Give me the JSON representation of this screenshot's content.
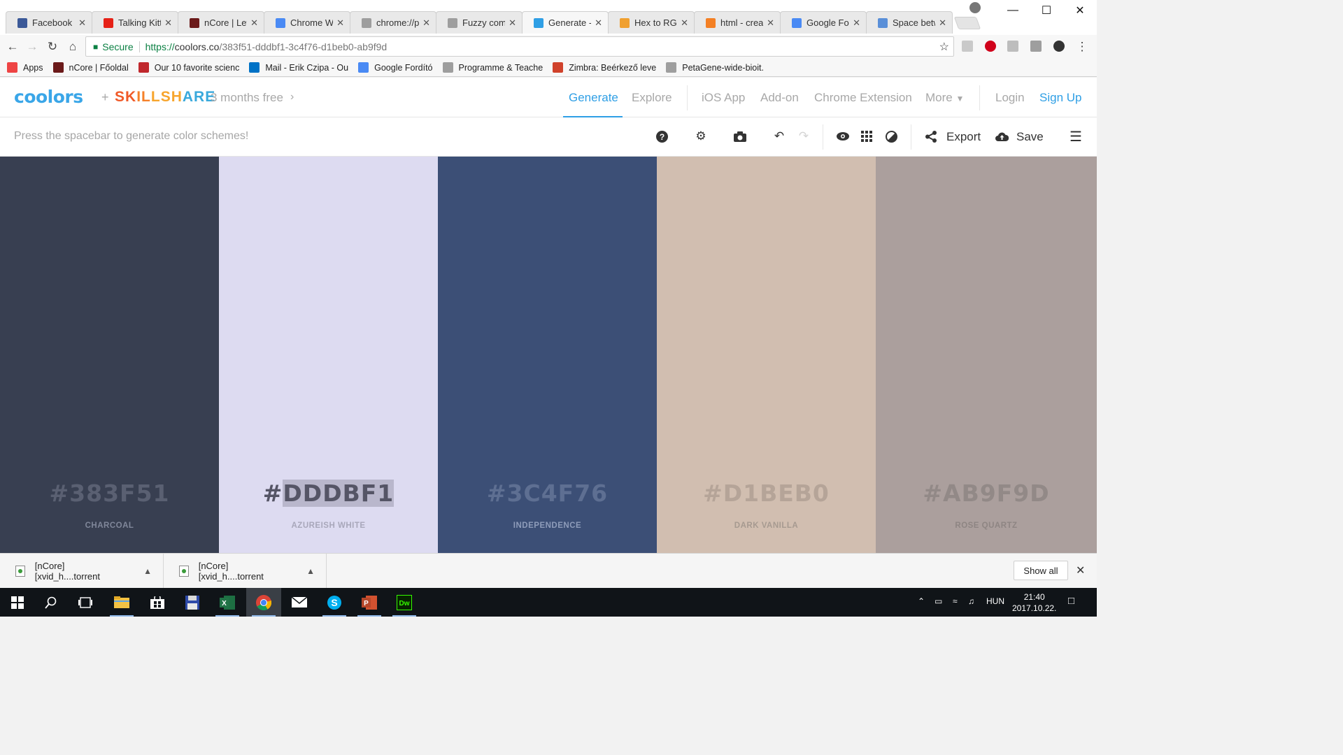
{
  "browser": {
    "tabs": [
      {
        "label": "Facebook",
        "icon": "facebook-icon",
        "color": "#3b5998"
      },
      {
        "label": "Talking Kitty",
        "icon": "youtube-icon",
        "color": "#e62117"
      },
      {
        "label": "nCore | Letöltés",
        "icon": "ncore-icon",
        "color": "#6b1a1a"
      },
      {
        "label": "Chrome Web Store",
        "icon": "chrome-webstore-icon",
        "color": "#4a8af4"
      },
      {
        "label": "chrome://plugins",
        "icon": "page-icon",
        "color": "#9e9e9e"
      },
      {
        "label": "Fuzzy comparison",
        "icon": "page-icon",
        "color": "#9e9e9e"
      },
      {
        "label": "Generate - Coolors",
        "icon": "coolors-icon",
        "color": "#2f9fe5",
        "active": true
      },
      {
        "label": "Hex to RGB",
        "icon": "r-icon",
        "color": "#f0a030"
      },
      {
        "label": "html - create",
        "icon": "stackoverflow-icon",
        "color": "#f48024"
      },
      {
        "label": "Google Fonts",
        "icon": "google-fonts-icon",
        "color": "#4a8af4"
      },
      {
        "label": "Space between",
        "icon": "codepen-icon",
        "color": "#5a8fd8"
      }
    ],
    "close_glyph": "✕",
    "address": {
      "secure_label": "Secure",
      "url_prefix": "https://",
      "url_host": "coolors.co",
      "url_path": "/383f51-dddbf1-3c4f76-d1beb0-ab9f9d"
    },
    "bookmarks": [
      {
        "label": "Apps",
        "icon": "apps-grid-icon",
        "color": "#e44"
      },
      {
        "label": "nCore | Főoldal",
        "icon": "ncore-icon",
        "color": "#6b1a1a"
      },
      {
        "label": "Our 10 favorite scienc",
        "icon": "s-icon",
        "color": "#c0282d"
      },
      {
        "label": "Mail - Erik Czipa - Ou",
        "icon": "outlook-icon",
        "color": "#0072c6"
      },
      {
        "label": "Google Fordító",
        "icon": "google-translate-icon",
        "color": "#4a8af4"
      },
      {
        "label": "Programme & Teache",
        "icon": "page-icon",
        "color": "#9e9e9e"
      },
      {
        "label": "Zimbra: Beérkező leve",
        "icon": "zimbra-icon",
        "color": "#d0422b"
      },
      {
        "label": "PetaGene-wide-bioit.",
        "icon": "page-icon",
        "color": "#9e9e9e"
      }
    ]
  },
  "coolors": {
    "logo": "coolors",
    "plus": "+",
    "skillshare": [
      {
        "t": "S",
        "c": "#f05a28"
      },
      {
        "t": "K",
        "c": "#f05a28"
      },
      {
        "t": "I",
        "c": "#f5812a"
      },
      {
        "t": "L",
        "c": "#f5812a"
      },
      {
        "t": "L",
        "c": "#f7a52d"
      },
      {
        "t": "S",
        "c": "#f7a52d"
      },
      {
        "t": "H",
        "c": "#f7a52d"
      },
      {
        "t": "A",
        "c": "#39a9dc"
      },
      {
        "t": "R",
        "c": "#39a9dc"
      },
      {
        "t": "E",
        "c": "#39a9dc"
      }
    ],
    "promo": "3 months free",
    "nav": {
      "generate": "Generate",
      "explore": "Explore",
      "ios": "iOS App",
      "addon": "Add-on",
      "chrome": "Chrome Extension",
      "more": "More",
      "login": "Login",
      "signup": "Sign Up"
    },
    "hint": "Press the spacebar to generate color schemes!",
    "toolbar": {
      "export": "Export",
      "save": "Save"
    },
    "palette": [
      {
        "hex_prefix": "#",
        "hex": "383F51",
        "name": "CHARCOAL",
        "bg": "#383f51",
        "hex_color": "#5a6072",
        "name_color": "#80879a"
      },
      {
        "hex_prefix": "#",
        "hex": "DDDBF1",
        "name": "AZUREISH WHITE",
        "bg": "#dddbf1",
        "hex_color": "#555566",
        "name_color": "#a8a7ba",
        "selected": true
      },
      {
        "hex_prefix": "#",
        "hex": "3C4F76",
        "name": "INDEPENDENCE",
        "bg": "#3c4f76",
        "hex_color": "#5e6f92",
        "name_color": "#8e9cba"
      },
      {
        "hex_prefix": "#",
        "hex": "D1BEB0",
        "name": "DARK VANILLA",
        "bg": "#d1beb0",
        "hex_color": "#b5a498",
        "name_color": "#a69a90"
      },
      {
        "hex_prefix": "#",
        "hex": "AB9F9D",
        "name": "ROSE QUARTZ",
        "bg": "#ab9f9d",
        "hex_color": "#928987",
        "name_color": "#8e8583"
      }
    ]
  },
  "downloads": {
    "items": [
      {
        "label": "[nCore][xvid_h....torrent"
      },
      {
        "label": "[nCore][xvid_h....torrent"
      }
    ],
    "show_all": "Show all"
  },
  "taskbar": {
    "language": "HUN",
    "time": "21:40",
    "date": "2017.10.22."
  }
}
